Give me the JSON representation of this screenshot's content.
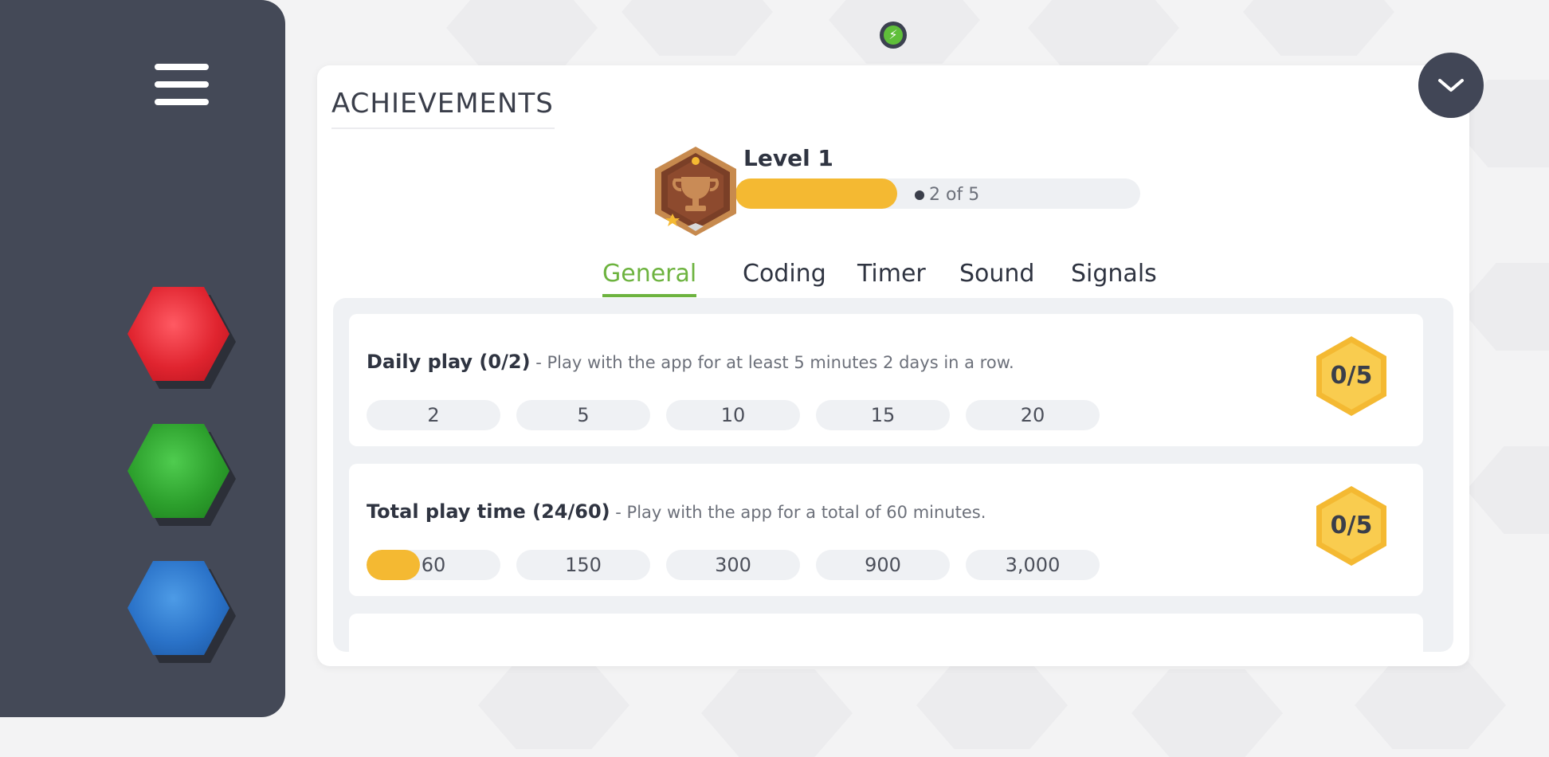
{
  "header": {
    "title": "ACHIEVEMENTS",
    "collapse_icon": "chevron-down-icon",
    "status_icon": "lightning-icon"
  },
  "sidebar": {
    "menu_icon": "hamburger-menu-icon",
    "buttons": [
      {
        "name": "red",
        "color": "#e0242f"
      },
      {
        "name": "green",
        "color": "#2c9f2c"
      },
      {
        "name": "blue",
        "color": "#2a72c8"
      }
    ]
  },
  "level": {
    "label": "Level 1",
    "progress_text": "2 of 5",
    "progress_fraction": 0.4,
    "badge_icon": "trophy-icon"
  },
  "tabs": [
    {
      "label": "General",
      "active": true
    },
    {
      "label": "Coding",
      "active": false
    },
    {
      "label": "Timer",
      "active": false
    },
    {
      "label": "Sound",
      "active": false
    },
    {
      "label": "Signals",
      "active": false
    }
  ],
  "achievements": [
    {
      "name": "Daily play (0/2)",
      "description": " - Play with the app for at least 5 minutes 2 days in a row.",
      "milestones": [
        "2",
        "5",
        "10",
        "15",
        "20"
      ],
      "first_milestone_progress": 0,
      "badge": "0/5"
    },
    {
      "name": "Total play time (24/60)",
      "description": " - Play with the app for a total of 60 minutes.",
      "milestones": [
        "60",
        "150",
        "300",
        "900",
        "3,000"
      ],
      "first_milestone_progress": 0.4,
      "badge": "0/5"
    }
  ],
  "colors": {
    "accent_green": "#6db33f",
    "progress_yellow": "#f4b932",
    "sidebar_bg": "#444957"
  }
}
